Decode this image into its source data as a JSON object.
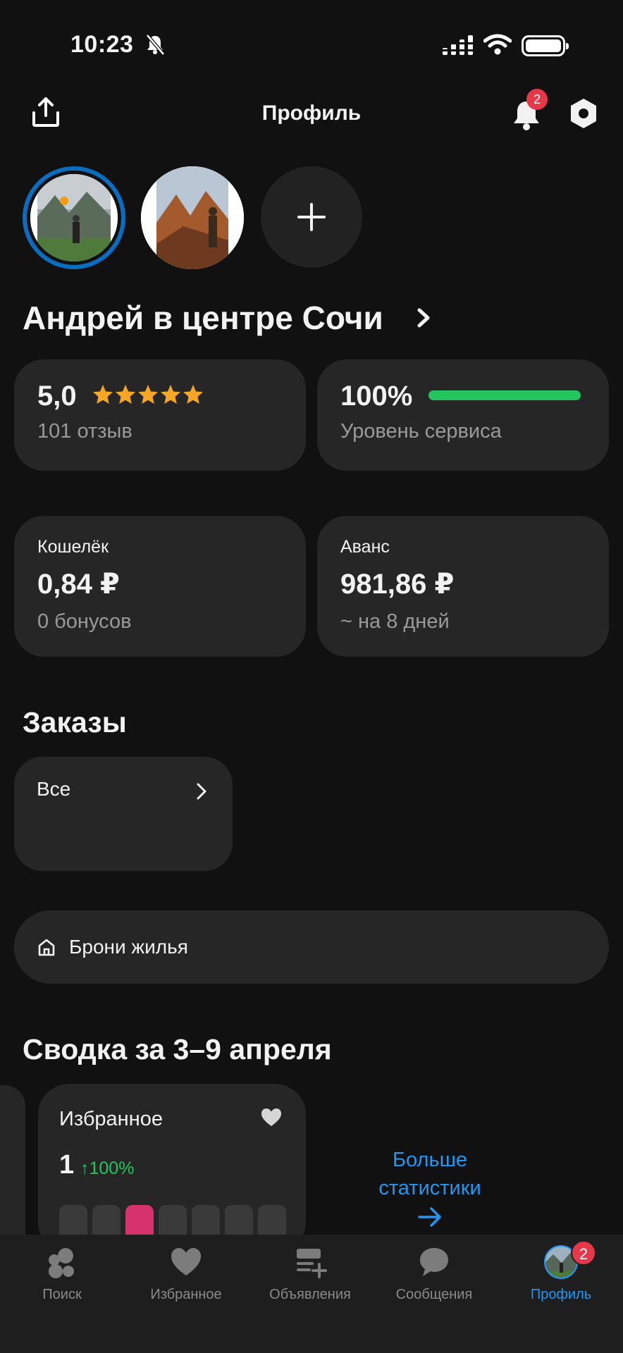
{
  "status_bar": {
    "time": "10:23"
  },
  "header": {
    "title": "Профиль",
    "notification_count": "2"
  },
  "profile": {
    "name": "Андрей в центре Сочи"
  },
  "rating": {
    "value": "5,0",
    "stars": 5,
    "reviews": "101 отзыв"
  },
  "service": {
    "percent": "100%",
    "level_fraction": 1.0,
    "label": "Уровень сервиса"
  },
  "wallet": {
    "title": "Кошелёк",
    "amount": "0,84 ₽",
    "bonus": "0 бонусов"
  },
  "advance": {
    "title": "Аванс",
    "amount": "981,86 ₽",
    "period": "~ на 8 дней"
  },
  "orders": {
    "heading": "Заказы",
    "all_label": "Все"
  },
  "bookings": {
    "label": "Брони жилья"
  },
  "summary": {
    "heading": "Сводка за 3–9 апреля",
    "favorites": {
      "title": "Избранное",
      "count": "1",
      "change": "↑100%",
      "bars_highlighted_index": 2
    },
    "more_stats": "Больше статистики"
  },
  "tabbar": {
    "items": [
      {
        "label": "Поиск",
        "icon": "search-dots-icon"
      },
      {
        "label": "Избранное",
        "icon": "heart-icon"
      },
      {
        "label": "Объявления",
        "icon": "listings-icon"
      },
      {
        "label": "Сообщения",
        "icon": "chat-icon"
      },
      {
        "label": "Профиль",
        "icon": "avatar-icon"
      }
    ],
    "active_index": 4,
    "profile_badge": "2"
  },
  "colors": {
    "accent": "#2296f3",
    "success": "#22c55e",
    "star": "#f5a623",
    "badge": "#e5384b",
    "highlight_bar": "#d6336c"
  }
}
